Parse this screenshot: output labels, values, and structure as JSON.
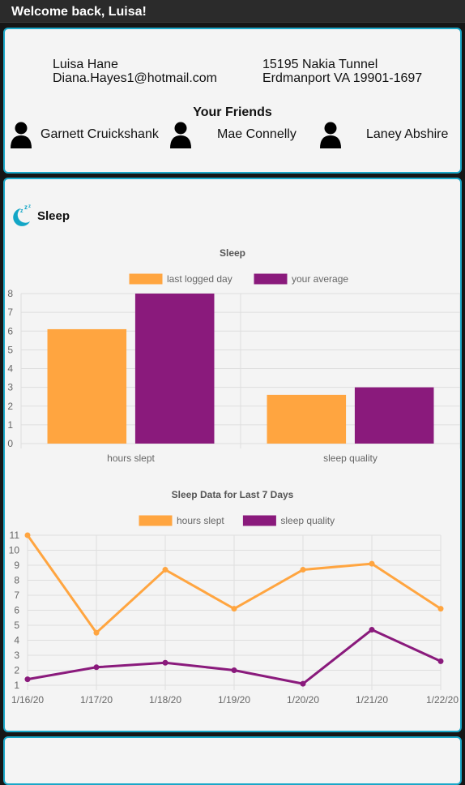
{
  "header": {
    "welcome": "Welcome back, Luisa!"
  },
  "user": {
    "name": "Luisa Hane",
    "email": "Diana.Hayes1@hotmail.com",
    "address_line1": "15195 Nakia Tunnel",
    "address_line2": "Erdmanport VA 19901-1697"
  },
  "friends": {
    "title": "Your Friends",
    "list": [
      "Garnett Cruickshank",
      "Mae Connelly",
      "Laney Abshire"
    ]
  },
  "sleep": {
    "title": "Sleep",
    "icon": "sleep-icon",
    "accent_color": "#13a6c6"
  },
  "chart_data": [
    {
      "type": "bar",
      "title": "Sleep",
      "categories": [
        "hours slept",
        "sleep quality"
      ],
      "series": [
        {
          "name": "last logged day",
          "values": [
            6.1,
            2.6
          ],
          "color": "#ffa540"
        },
        {
          "name": "your average",
          "values": [
            8.0,
            3.0
          ],
          "color": "#8a1a7c"
        }
      ],
      "ylim": [
        0,
        8
      ],
      "yticks": [
        0,
        1,
        2,
        3,
        4,
        5,
        6,
        7,
        8
      ],
      "grid": true,
      "legend": "top"
    },
    {
      "type": "line",
      "title": "Sleep Data for Last 7 Days",
      "x": [
        "1/16/20",
        "1/17/20",
        "1/18/20",
        "1/19/20",
        "1/20/20",
        "1/21/20",
        "1/22/20"
      ],
      "series": [
        {
          "name": "hours slept",
          "values": [
            11,
            4.5,
            8.7,
            6.1,
            8.7,
            9.1,
            6.1
          ],
          "color": "#ffa540"
        },
        {
          "name": "sleep quality",
          "values": [
            1.4,
            2.2,
            2.5,
            2.0,
            1.1,
            4.7,
            2.6
          ],
          "color": "#8a1a7c"
        }
      ],
      "ylim": [
        1,
        11
      ],
      "yticks": [
        1,
        2,
        3,
        4,
        5,
        6,
        7,
        8,
        9,
        10,
        11
      ],
      "grid": true,
      "legend": "top"
    }
  ]
}
